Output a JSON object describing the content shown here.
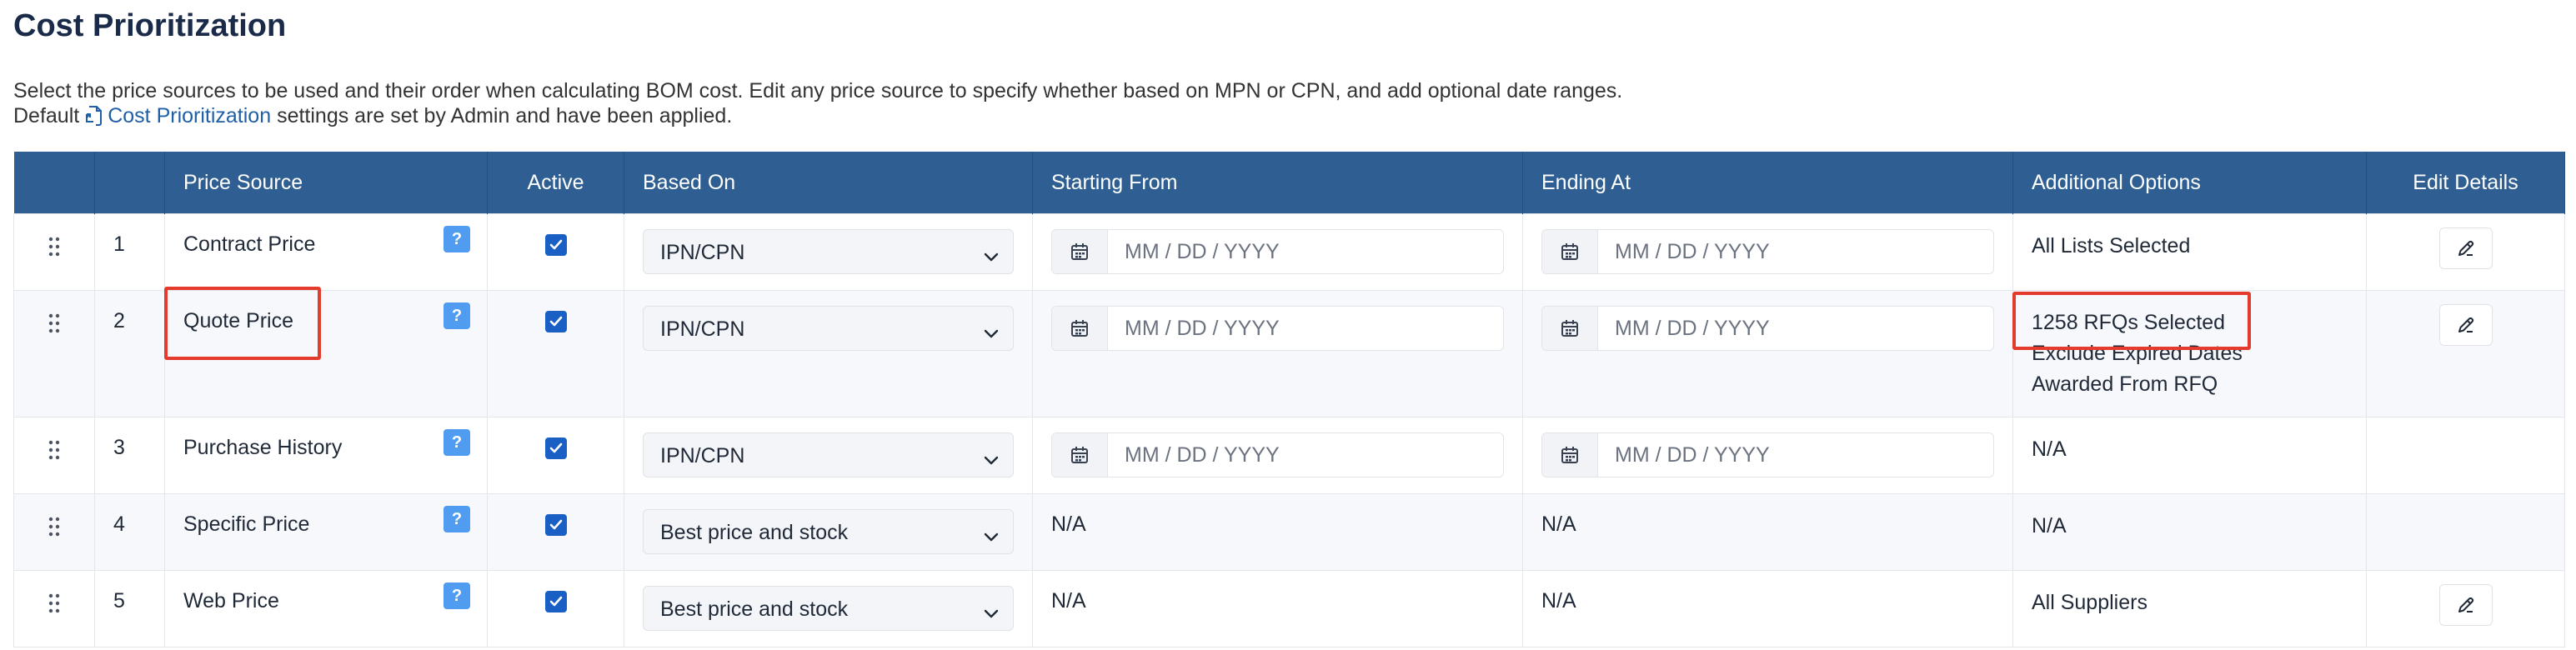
{
  "page": {
    "title": "Cost Prioritization",
    "description_line1": "Select the price sources to be used and their order when calculating BOM cost. Edit any price source to specify whether based on MPN or CPN, and add optional date ranges.",
    "description_line2_prefix": "Default",
    "description_link": "Cost Prioritization",
    "description_line2_suffix": "settings are set by Admin and have been applied."
  },
  "table": {
    "headers": {
      "price_source": "Price Source",
      "active": "Active",
      "based_on": "Based On",
      "starting_from": "Starting From",
      "ending_at": "Ending At",
      "additional_options": "Additional Options",
      "edit_details": "Edit Details"
    },
    "help_glyph": "?",
    "date_placeholder": "MM / DD / YYYY",
    "rows": [
      {
        "index": "1",
        "price_source": "Contract Price",
        "active": true,
        "based_on": "IPN/CPN",
        "starting_from": "",
        "ending_at": "",
        "options": [
          "All Lists Selected"
        ],
        "editable": true
      },
      {
        "index": "2",
        "price_source": "Quote Price",
        "active": true,
        "based_on": "IPN/CPN",
        "starting_from": "",
        "ending_at": "",
        "options": [
          "1258 RFQs Selected",
          "Exclude Expired Dates",
          "Awarded From RFQ"
        ],
        "editable": true
      },
      {
        "index": "3",
        "price_source": "Purchase History",
        "active": true,
        "based_on": "IPN/CPN",
        "starting_from": "",
        "ending_at": "",
        "options": [
          "N/A"
        ],
        "editable": false
      },
      {
        "index": "4",
        "price_source": "Specific Price",
        "active": true,
        "based_on": "Best price and stock",
        "starting_from": "N/A",
        "ending_at": "N/A",
        "options": [
          "N/A"
        ],
        "editable": false
      },
      {
        "index": "5",
        "price_source": "Web Price",
        "active": true,
        "based_on": "Best price and stock",
        "starting_from": "N/A",
        "ending_at": "N/A",
        "options": [
          "All Suppliers"
        ],
        "editable": true
      }
    ]
  },
  "colors": {
    "header_bg": "#2f5f92",
    "checkbox": "#1a5fc4",
    "help_badge": "#4f9cf0",
    "highlight": "#e53a2e",
    "link": "#1f5fa8"
  }
}
